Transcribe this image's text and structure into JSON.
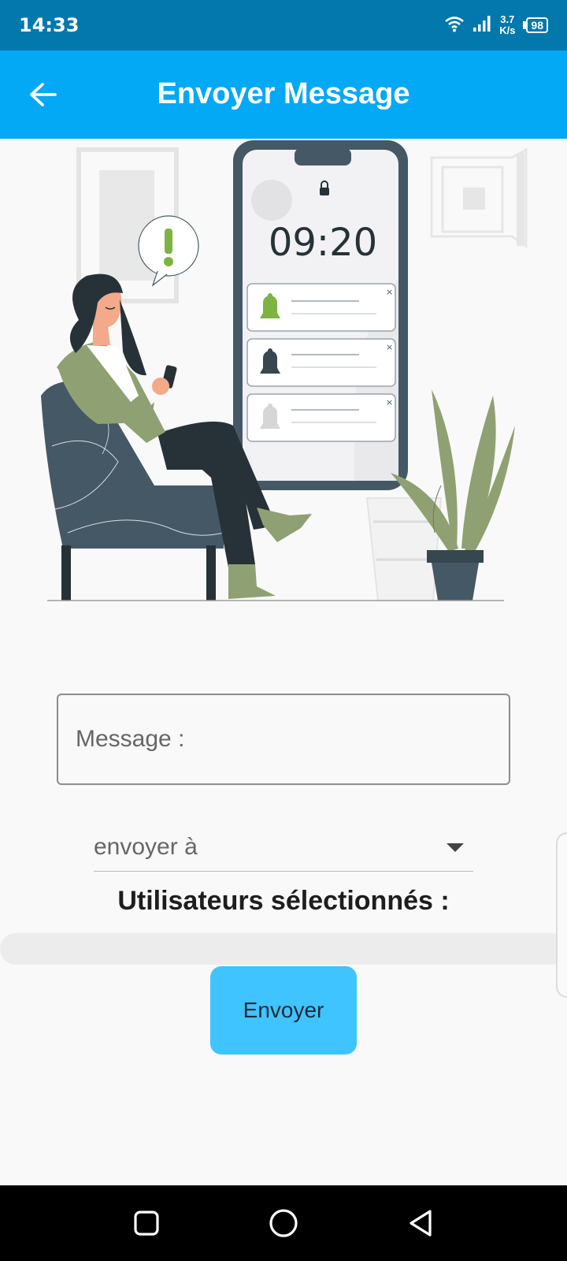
{
  "status_bar": {
    "time": "14:33",
    "net_speed_value": "3.7",
    "net_speed_unit": "K/s",
    "battery": "98",
    "icons": [
      "wifi-icon",
      "signal-icon",
      "battery-icon"
    ]
  },
  "app_bar": {
    "title": "Envoyer Message",
    "back_icon": "arrow-left-icon",
    "color": "#03a9f4"
  },
  "illustration": {
    "clock_time": "09:20",
    "notification_icons": [
      "bell-icon",
      "bell-icon",
      "bell-icon"
    ]
  },
  "form": {
    "message_placeholder": "Message :",
    "recipient_dropdown_label": "envoyer à",
    "selected_users_title": "Utilisateurs sélectionnés :",
    "send_button_label": "Envoyer",
    "send_button_color": "#40c4ff"
  },
  "nav_bar": {
    "icons": [
      "square-icon",
      "circle-icon",
      "triangle-back-icon"
    ]
  }
}
